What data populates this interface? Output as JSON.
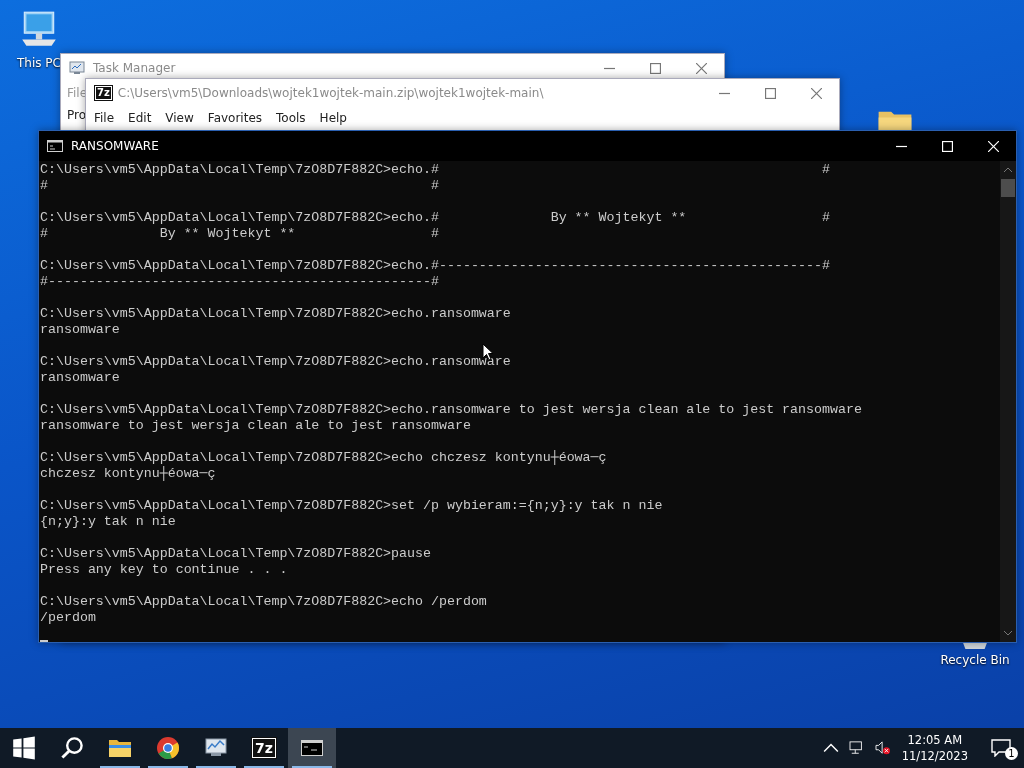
{
  "desktop": {
    "icons": [
      {
        "kind": "pc",
        "label": "This PC"
      },
      {
        "kind": "folder"
      },
      {
        "kind": "recycle",
        "label": "Recycle Bin"
      }
    ]
  },
  "task_manager": {
    "title": "Task Manager",
    "menu": [
      "File"
    ],
    "tabs": [
      "Pro"
    ]
  },
  "archive_window": {
    "logo": "7z",
    "title": "C:\\Users\\vm5\\Downloads\\wojtek1wojtek-main.zip\\wojtek1wojtek-main\\",
    "menu": [
      "File",
      "Edit",
      "View",
      "Favorites",
      "Tools",
      "Help"
    ]
  },
  "console": {
    "title": "RANSOMWARE",
    "blocks": [
      {
        "command": "C:\\Users\\vm5\\AppData\\Local\\Temp\\7zO8D7F882C>echo.#                                                #",
        "output": [
          "#                                                #"
        ]
      },
      {
        "command": "C:\\Users\\vm5\\AppData\\Local\\Temp\\7zO8D7F882C>echo.#              By ** Wojtekyt **                 #",
        "output": [
          "#              By ** Wojtekyt **                 #"
        ]
      },
      {
        "command": "C:\\Users\\vm5\\AppData\\Local\\Temp\\7zO8D7F882C>echo.#------------------------------------------------#",
        "output": [
          "#------------------------------------------------#"
        ]
      },
      {
        "command": "C:\\Users\\vm5\\AppData\\Local\\Temp\\7zO8D7F882C>echo.ransomware",
        "output": [
          "ransomware"
        ]
      },
      {
        "command": "C:\\Users\\vm5\\AppData\\Local\\Temp\\7zO8D7F882C>echo.ransomware",
        "output": [
          "ransomware"
        ]
      },
      {
        "command": "C:\\Users\\vm5\\AppData\\Local\\Temp\\7zO8D7F882C>echo.ransomware to jest wersja clean ale to jest ransomware",
        "output": [
          "ransomware to jest wersja clean ale to jest ransomware"
        ]
      },
      {
        "command": "C:\\Users\\vm5\\AppData\\Local\\Temp\\7zO8D7F882C>echo chczesz kontynu┼éowa─ç",
        "output": [
          "chczesz kontynu┼éowa─ç"
        ]
      },
      {
        "command": "C:\\Users\\vm5\\AppData\\Local\\Temp\\7zO8D7F882C>set /p wybieram:={n;y}:y tak n nie",
        "output": [
          "{n;y}:y tak n nie"
        ]
      },
      {
        "command": "C:\\Users\\vm5\\AppData\\Local\\Temp\\7zO8D7F882C>pause",
        "output": [
          "Press any key to continue . . ."
        ]
      },
      {
        "command": "C:\\Users\\vm5\\AppData\\Local\\Temp\\7zO8D7F882C>echo /perdom",
        "output": [
          "/perdom"
        ]
      }
    ]
  },
  "taskbar": {
    "apps": [
      {
        "kind": "explorer",
        "selected": false
      },
      {
        "kind": "browser",
        "selected": false
      },
      {
        "kind": "taskmgr",
        "selected": false
      },
      {
        "kind": "archiver",
        "label": "7z",
        "selected": false
      },
      {
        "kind": "console",
        "selected": true
      }
    ],
    "tray": {
      "time": "12:05 AM",
      "date": "11/12/2023",
      "notifications": "1"
    }
  }
}
